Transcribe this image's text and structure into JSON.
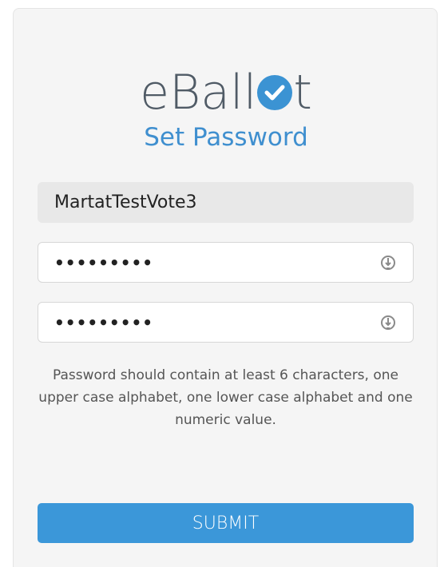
{
  "brand": {
    "prefix": "eBall",
    "suffix": "t",
    "accent_color": "#3b93d3"
  },
  "page_title": "Set Password",
  "username_field": {
    "value": "MartatTestVote3"
  },
  "password_field": {
    "masked_value": "•••••••••",
    "icon": "eye-toggle-icon"
  },
  "confirm_password_field": {
    "masked_value": "•••••••••",
    "icon": "eye-toggle-icon"
  },
  "hint": "Password should contain at least 6 characters, one upper case alphabet, one lower case alphabet and one numeric value.",
  "submit_button": {
    "label": "SUBMIT",
    "color": "#3b97d9"
  }
}
